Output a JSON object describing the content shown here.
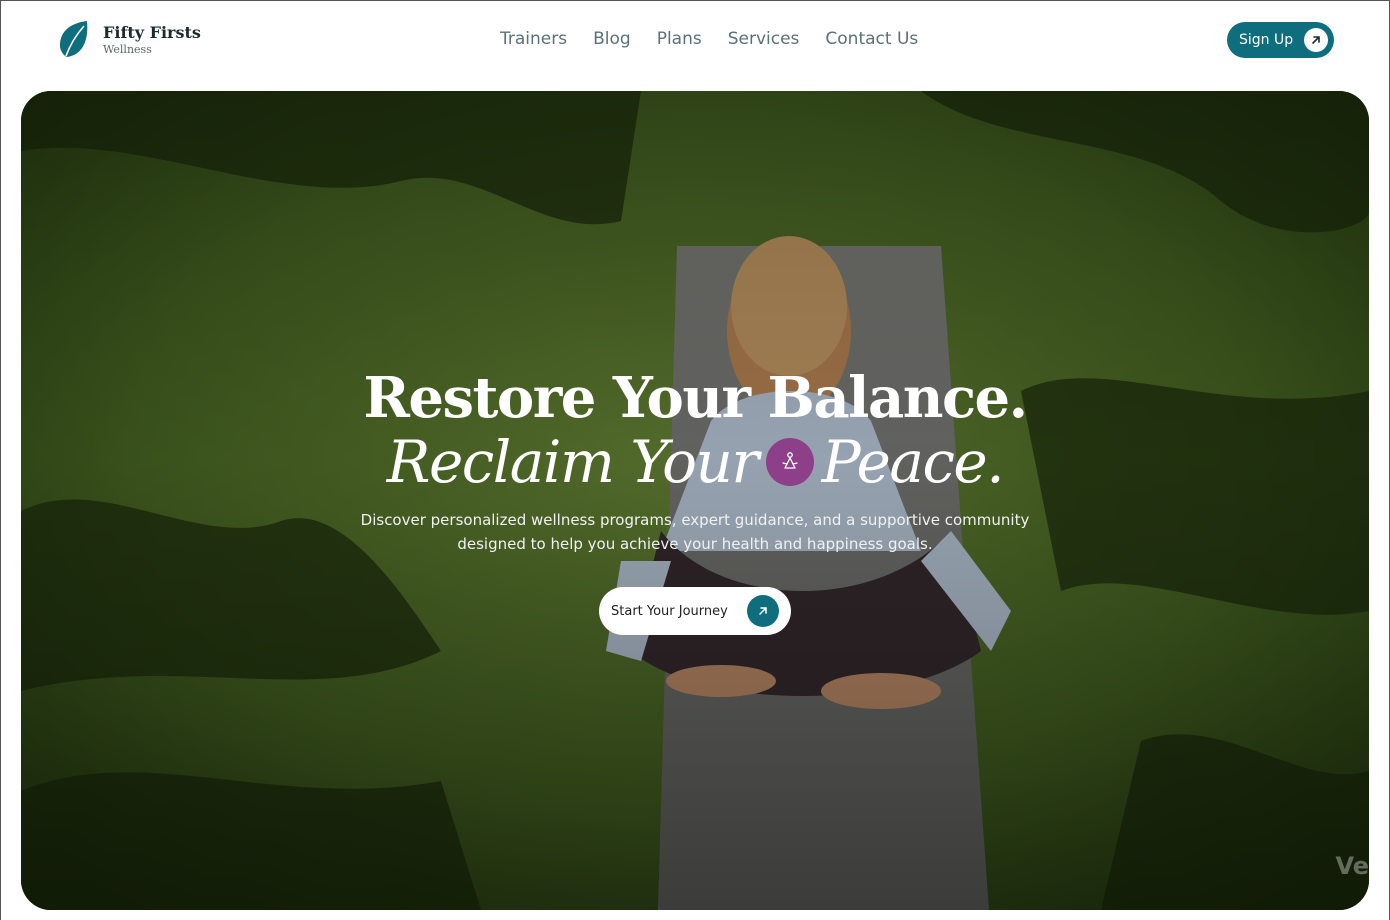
{
  "brand": {
    "name": "Fifty Firsts",
    "tagline": "Wellness"
  },
  "nav": {
    "items": [
      {
        "label": "Trainers"
      },
      {
        "label": "Blog"
      },
      {
        "label": "Plans"
      },
      {
        "label": "Services"
      },
      {
        "label": "Contact Us"
      }
    ]
  },
  "header": {
    "signup_label": "Sign Up",
    "signup_icon": "arrow-up-right-icon"
  },
  "hero": {
    "headline_line1": "Restore Your Balance.",
    "headline_line2_a": "Reclaim Your",
    "headline_line2_b": "Peace.",
    "badge_icon": "meditation-icon",
    "subtext_line1": "Discover personalized wellness programs, expert guidance, and a supportive community",
    "subtext_line2": "designed to help you achieve your health and happiness goals.",
    "cta_label": "Start Your Journey",
    "cta_icon": "arrow-up-right-icon",
    "watermark": "Ve"
  },
  "colors": {
    "brand_teal": "#0f6e7e",
    "badge_purple": "#8e3f8a",
    "nav_text": "#5b7178"
  }
}
